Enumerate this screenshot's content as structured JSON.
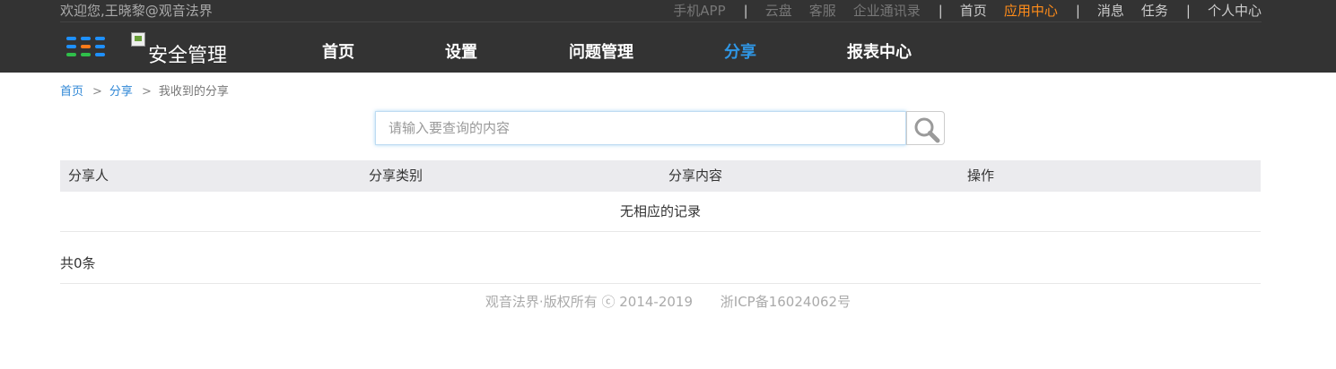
{
  "topbar": {
    "welcome": "欢迎您,王晓黎@观音法界",
    "links": {
      "app": "手机APP",
      "sep": "|",
      "cloud": "云盘",
      "service": "客服",
      "contacts": "企业通讯录",
      "home": "首页",
      "appcenter": "应用中心",
      "messages": "消息",
      "tasks": "任务",
      "personal": "个人中心"
    }
  },
  "logo": {
    "alt": "安全管理"
  },
  "nav": {
    "home": "首页",
    "settings": "设置",
    "issues": "问题管理",
    "share": "分享",
    "reports": "报表中心"
  },
  "breadcrumb": {
    "home": "首页",
    "sep": ">",
    "share": "分享",
    "current": "我收到的分享"
  },
  "search": {
    "placeholder": "请输入要查询的内容",
    "value": ""
  },
  "table": {
    "headers": [
      "分享人",
      "分享类别",
      "分享内容",
      "操作"
    ],
    "empty_text": "无相应的记录"
  },
  "total": "共0条",
  "footer": {
    "copyright": "观音法界·版权所有 ⓒ 2014-2019",
    "icp": "浙ICP备16024062号"
  },
  "colors": {
    "topbar_bg": "#333333",
    "accent_orange": "#ff8c1a",
    "accent_blue": "#2f97e6",
    "table_header_bg": "#ebebee"
  }
}
